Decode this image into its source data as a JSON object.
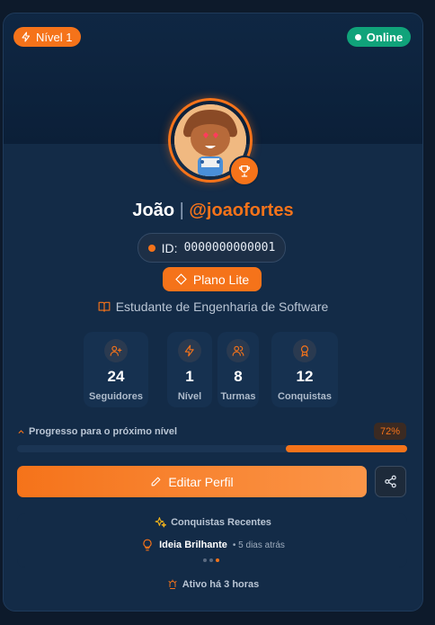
{
  "header": {
    "level_badge": "Nível 1",
    "status_badge": "Online"
  },
  "profile": {
    "name": "João",
    "separator": "|",
    "handle": "@joaofortes",
    "id_label": "ID:",
    "id_value": "0000000000001",
    "plan": "Plano Lite",
    "role": "Estudante de Engenharia de Software"
  },
  "stats": [
    {
      "icon": "user-plus-icon",
      "value": "24",
      "label": "Seguidores"
    },
    {
      "icon": "bolt-icon",
      "value": "1",
      "label": "Nível"
    },
    {
      "icon": "users-icon",
      "value": "8",
      "label": "Turmas"
    },
    {
      "icon": "award-icon",
      "value": "12",
      "label": "Conquistas"
    }
  ],
  "progress": {
    "label": "Progresso para o próximo nível",
    "percent_text": "72%",
    "percent": 0.72
  },
  "actions": {
    "edit_label": "Editar Perfil"
  },
  "achievements": {
    "title": "Conquistas Recentes",
    "item_name": "Ideia Brilhante",
    "item_time": "• 5 dias atrás"
  },
  "activity": {
    "text": "Ativo há 3 horas"
  },
  "colors": {
    "accent": "#f5731a",
    "online": "#10a37a",
    "card": "#132b47"
  }
}
